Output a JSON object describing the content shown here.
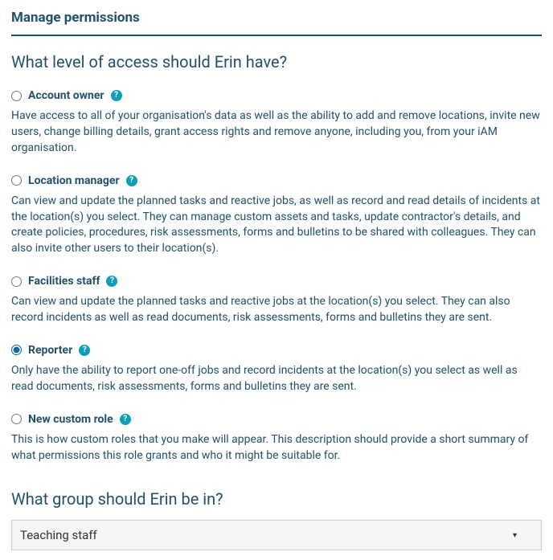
{
  "header": {
    "title": "Manage permissions"
  },
  "access": {
    "title": "What level of access should Erin have?",
    "roles": [
      {
        "label": "Account owner",
        "description": "Have access to all of your organisation's data as well as the ability to add and remove locations, invite new users, change billing details, grant access rights and remove anyone, including you, from your iAM organisation.",
        "selected": false
      },
      {
        "label": "Location manager",
        "description": "Can view and update the planned tasks and reactive jobs, as well as record and read details of incidents at the location(s) you select. They can manage custom assets and tasks, update contractor's details, and create policies, procedures, risk assessments, forms and bulletins to be shared with colleagues. They can also invite other users to their location(s).",
        "selected": false
      },
      {
        "label": "Facilities staff",
        "description": "Can view and update the planned tasks and reactive jobs at the location(s) you select. They can also record incidents as well as read documents, risk assessments, forms and bulletins they are sent.",
        "selected": false
      },
      {
        "label": "Reporter",
        "description": "Only have the ability to report one-off jobs and record incidents at the location(s) you select as well as read documents, risk assessments, forms and bulletins they are sent.",
        "selected": true
      },
      {
        "label": "New custom role",
        "description": "This is how custom roles that you make will appear. This description should provide a short summary of what permissions this role grants and who it might be suitable for.",
        "selected": false
      }
    ]
  },
  "group": {
    "title": "What group should Erin be in?",
    "selected": "Teaching staff"
  }
}
